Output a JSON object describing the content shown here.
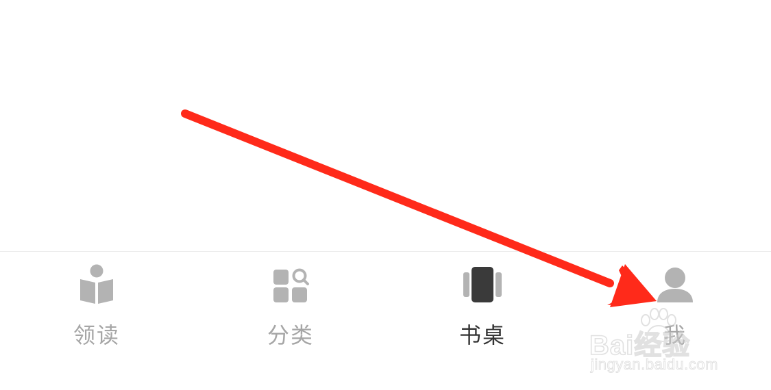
{
  "tabbar": {
    "tabs": [
      {
        "label": "领读",
        "icon": "reading-person-icon",
        "active": false
      },
      {
        "label": "分类",
        "icon": "category-search-icon",
        "active": false
      },
      {
        "label": "书桌",
        "icon": "bookshelf-desk-icon",
        "active": true
      },
      {
        "label": "我",
        "icon": "user-profile-icon",
        "active": false
      }
    ]
  },
  "colors": {
    "inactive": "#a6a6a6",
    "active": "#333333",
    "icon_inactive": "#b3b3b3",
    "icon_active": "#3a3a3a",
    "annotation_arrow": "#ff2a1a"
  },
  "watermark": {
    "brand_text": "Bai经验",
    "url_text": "jingyan.baidu.com"
  }
}
